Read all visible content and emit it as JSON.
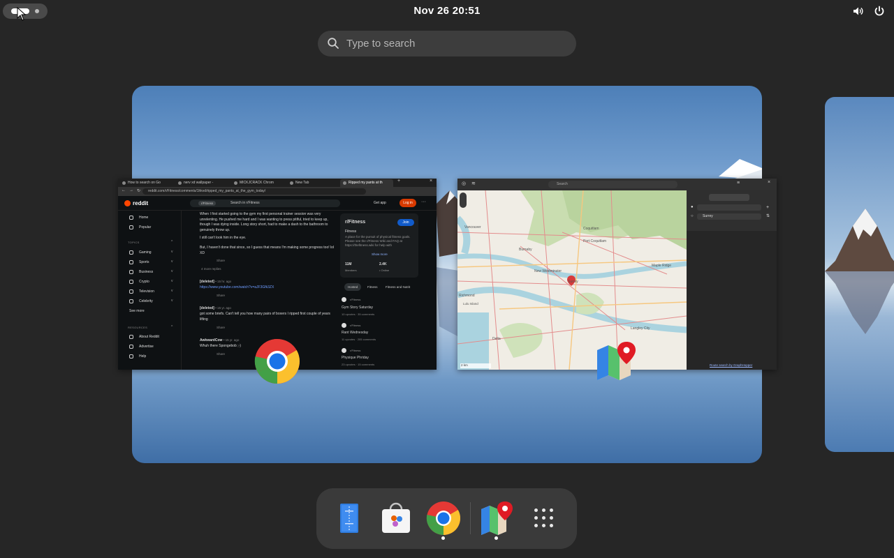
{
  "topbar": {
    "clock": "Nov 26  20:51",
    "activities_icon": "activities-icon",
    "tray_icons": [
      "volume-icon",
      "power-icon"
    ]
  },
  "search": {
    "placeholder": "Type to search",
    "icon": "search-icon"
  },
  "windows": {
    "chrome": {
      "tabs": [
        "How to search on Go",
        "nerv xd wallpaper -",
        "MICKJCRACK Chrom",
        "New Tab",
        "Ripped my pants at th"
      ],
      "url": "reddit.com/r/Fitness/comments/1hkvd/ripped_my_pants_at_the_gym_today/",
      "brand": "reddit",
      "search_chip": "r/Fitness",
      "search_placeholder": "Search in r/Fitness",
      "get_app": "Get app",
      "login": "Log in",
      "sidebar": {
        "home": "Home",
        "popular": "Popular",
        "topics_header": "TOPICS",
        "topics": [
          "Gaming",
          "Sports",
          "Business",
          "Crypto",
          "Television",
          "Celebrity"
        ],
        "see_more": "See more",
        "resources_header": "RESOURCES",
        "resources": [
          "About Reddit",
          "Advertise",
          "Help"
        ]
      },
      "feed": {
        "post_text_1": "When I first started going to the gym my first personal trainer session was very unrelenting. He pushed me hard and I was wanting to press pitiful, tried to keep up, though I was dying inside. Long story short, had to make a dash to the bathroom to genuinely throw up.",
        "post_text_2": "I still can't look him in the eye.",
        "post_text_3": "But, I haven't done that since, so I guess that means I'm making some progress too! lol XD",
        "reply_1_user": "[deleted]",
        "reply_1_time": "• 15 hr. ago",
        "reply_1_link": "https://www.youtube.com/watch?v=aJF3Gfk3ZX",
        "reply_2_user": "[deleted]",
        "reply_2_time": "• 15 yr. ago",
        "reply_2_text": "got some briefs. Can't tell you how many pairs of boxers I ripped first couple of years lifting",
        "reply_3_user": "AwkwardCow",
        "reply_3_time": "• 15 yr. ago",
        "reply_3_text": "Whuh there Spongebob ;-)",
        "share": "Share",
        "more_replies": "4 more replies"
      },
      "community": {
        "name": "r/Fitness",
        "join": "Join",
        "title": "Fitness",
        "description": "A place for the pursuit of physical fitness goals. Please see the r/Fitness Wiki and FAQ at https://thefitness.wiki for help with",
        "show_more": "Show more",
        "members_value": "11M",
        "members_label": "Members",
        "online_value": "2.4K",
        "online_label": "• Online"
      },
      "pills": [
        "Hosted",
        "Fitness",
        "Fitness and Nutrit"
      ],
      "posts": [
        {
          "sub": "r/Fitness",
          "title": "Gym Story Saturday",
          "meta": "10 upvotes  · 35 comments"
        },
        {
          "sub": "r/Fitness",
          "title": "Rant Wednesday",
          "meta": "11 upvotes  · 205 comments"
        },
        {
          "sub": "r/Fitness",
          "title": "Physique Phriday",
          "meta": "23 upvotes  · 15 comments"
        }
      ]
    },
    "maps": {
      "search_placeholder": "Search",
      "places": [
        "Vancouver",
        "Burnaby",
        "Port Coquitlam",
        "Coquitlam",
        "New Westminster",
        "Richmond",
        "Surrey",
        "Delta",
        "Maple Ridge",
        "Langley City",
        "Lulu Island"
      ],
      "panel_field_1": "",
      "panel_field_2": "Surrey",
      "footer_link": "Route search by GraphHopper",
      "scale": "2 km"
    }
  },
  "app_icons": [
    "chrome-icon",
    "maps-icon"
  ],
  "dock": {
    "items": [
      "text-editor-icon",
      "software-center-icon",
      "chrome-icon",
      "maps-icon",
      "show-apps-icon"
    ]
  }
}
